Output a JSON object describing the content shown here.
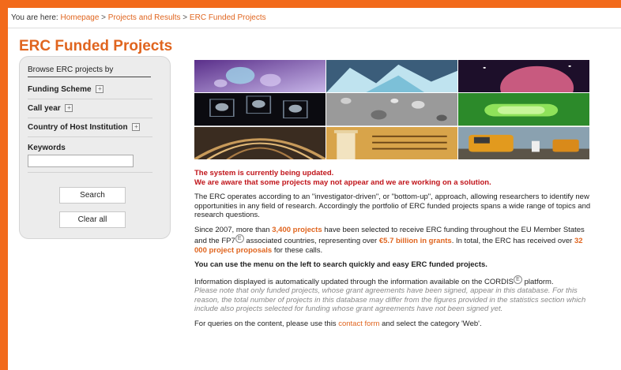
{
  "breadcrumb": {
    "prefix": "You are here:",
    "items": [
      "Homepage",
      "Projects and Results",
      "ERC Funded Projects"
    ],
    "separator": ">"
  },
  "page_title": "ERC Funded Projects",
  "sidebar": {
    "heading": "Browse ERC projects by",
    "items": [
      {
        "label": "Funding Scheme",
        "expand_icon": "plus-box-icon"
      },
      {
        "label": "Call year",
        "expand_icon": "plus-box-icon"
      },
      {
        "label": "Country of Host Institution",
        "expand_icon": "plus-box-icon"
      }
    ],
    "keywords_label": "Keywords",
    "keywords_value": "",
    "search_label": "Search",
    "clear_label": "Clear all"
  },
  "content": {
    "warning_line1": "The system is currently being updated.",
    "warning_line2": "We are aware that some projects may not appear and we are working on a solution.",
    "intro": "The ERC operates according to an \"investigator-driven\", or \"bottom-up\", approach, allowing researchers to identify new opportunities in any field of research. Accordingly the portfolio of ERC funded projects spans a wide range of topics and research questions.",
    "stats_a": "Since 2007, more than ",
    "stats_projects": "3,400 projects",
    "stats_b": " have been selected to receive ERC funding throughout the EU Member States and the FP7",
    "stats_c": " associated countries, representing over ",
    "stats_grants": "€5.7 billion in grants",
    "stats_d": ". In total, the ERC has received over ",
    "stats_proposals": "32 000 project proposals",
    "stats_e": " for these calls.",
    "menu_hint": "You can use the menu on the left to search quickly and easy ERC funded projects.",
    "info_a": "Information displayed is automatically updated through the information available on the CORDIS",
    "info_b": " platform.",
    "note": "Please note that only funded projects, whose grant agreements have been signed, appear in this database. For this reason, the total number of projects in this database may differ from the figures provided in the statistics section which include also projects selected for funding whose grant agreements have not been signed yet.",
    "queries_a": "For queries on the content, please use this ",
    "queries_link": "contact form",
    "queries_b": " and select the category 'Web'."
  },
  "colors": {
    "accent": "#e0651f",
    "warning": "#c0141a",
    "frame": "#f26a1b"
  }
}
